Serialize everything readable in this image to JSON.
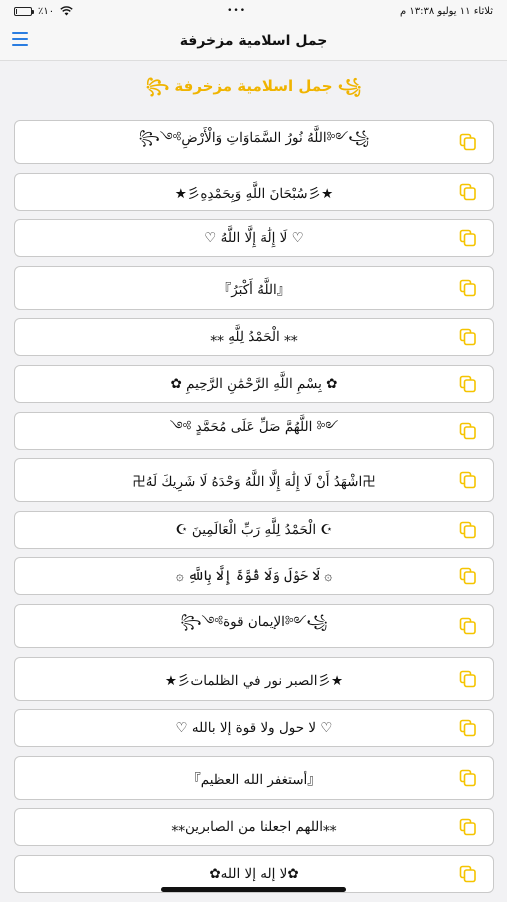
{
  "status_bar": {
    "battery_text": "٪١٠",
    "dots": "•••",
    "datetime": "ثلاثاء ١١ يوليو  ١٣:٣٨ م",
    "battery_level": 0.1
  },
  "navbar": {
    "title": "جمل اسلامية مزخرفة"
  },
  "header": {
    "decorated_title": "꧁ جمل اسلامية مزخرفة ꧂"
  },
  "phrases": [
    {
      "text": "꧁༺اللَّهُ نُورُ السَّمَاوَاتِ وَالْأَرْضِ༻꧂",
      "tall": true
    },
    {
      "text": "★彡سُبْحَانَ اللَّهِ وَبِحَمْدِهِ彡★",
      "tall": false
    },
    {
      "text": "♡ لَا إِلَٰهَ إِلَّا اللَّهُ ♡",
      "tall": false
    },
    {
      "text": "『اللَّهُ أَكْبَرُ』",
      "tall": true
    },
    {
      "text": "⁎⁎ الْحَمْدُ لِلَّهِ ⁎⁎",
      "tall": false
    },
    {
      "text": "✿ بِسْمِ اللَّهِ الرَّحْمَٰنِ الرَّحِيمِ ✿",
      "tall": false
    },
    {
      "text": "༺ اللَّهُمَّ صَلِّ عَلَى مُحَمَّدٍ ༻",
      "tall": false
    },
    {
      "text": "卍اشْهَدُ أَنْ لَا إِلَٰهَ إِلَّا اللَّهُ وَحْدَهُ لَا شَرِيكَ لَهُ卍",
      "tall": true
    },
    {
      "text": "☪ الْحَمْدُ لِلَّهِ رَبِّ الْعَالَمِينَ ☪",
      "tall": false
    },
    {
      "text": "۞ لَا حَوْلَ وَلَا قُوَّةَ إِلَّا بِاللَّهِ ۞",
      "tall": false
    },
    {
      "text": "꧁༺الإيمان قوة༻꧂",
      "tall": true
    },
    {
      "text": "★彡الصبر نور في الظلمات彡★",
      "tall": true
    },
    {
      "text": "♡ لا حول ولا قوة إلا بالله ♡",
      "tall": false
    },
    {
      "text": "『أستغفر الله العظيم』",
      "tall": true
    },
    {
      "text": "⁎⁎اللهم اجعلنا من الصابرين⁎⁎",
      "tall": false
    },
    {
      "text": "✿لا إله إلا الله✿",
      "tall": false
    }
  ],
  "colors": {
    "accent": "#f0b400",
    "menu": "#2a7de1",
    "copy_icon": "#f5c400"
  },
  "icons": {
    "menu": "hamburger-menu-icon",
    "copy": "copy-icon"
  }
}
